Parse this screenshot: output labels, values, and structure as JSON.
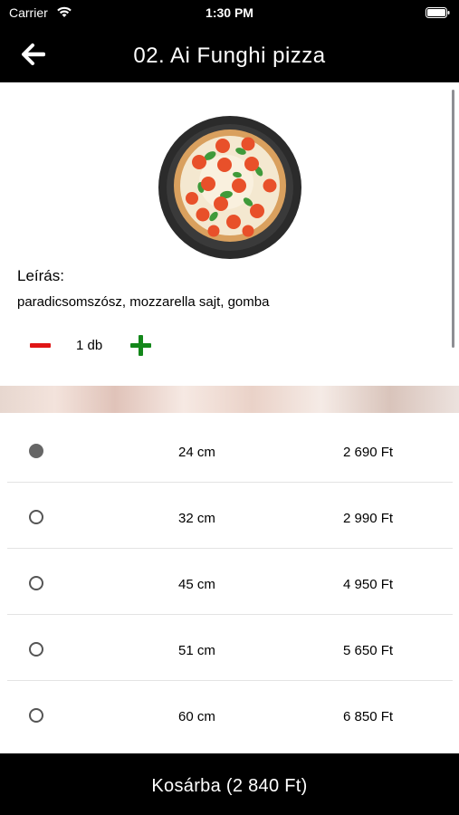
{
  "status": {
    "carrier": "Carrier",
    "time": "1:30 PM"
  },
  "header": {
    "title": "02. Ai Funghi pizza"
  },
  "product": {
    "description_heading": "Leírás:",
    "description": "paradicsomszósz, mozzarella sajt, gomba",
    "quantity": "1 db"
  },
  "sizes": [
    {
      "size": "24 cm",
      "price": "2 690 Ft",
      "selected": true
    },
    {
      "size": "32 cm",
      "price": "2 990 Ft",
      "selected": false
    },
    {
      "size": "45 cm",
      "price": "4 950 Ft",
      "selected": false
    },
    {
      "size": "51 cm",
      "price": "5 650 Ft",
      "selected": false
    },
    {
      "size": "60 cm",
      "price": "6 850 Ft",
      "selected": false
    }
  ],
  "cart": {
    "label": "Kosárba (2 840 Ft)"
  },
  "icons": {
    "back": "back-arrow-icon",
    "wifi": "wifi-icon",
    "battery": "battery-icon",
    "minus": "minus-icon",
    "plus": "plus-icon"
  },
  "colors": {
    "minus": "#e01515",
    "plus": "#13871a",
    "bar": "#000000"
  }
}
